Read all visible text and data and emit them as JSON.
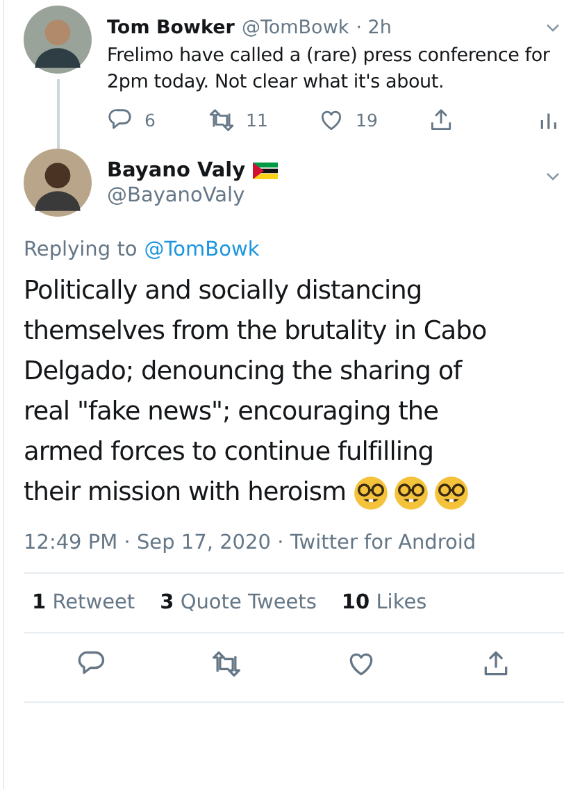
{
  "parent_tweet": {
    "name": "Tom Bowker",
    "handle": "@TomBowk",
    "time": "· 2h",
    "text": "Frelimo have called a (rare) press conference for 2pm today. Not clear what it's about.",
    "actions": [
      {
        "kind": "reply",
        "count": "6"
      },
      {
        "kind": "retweet",
        "count": "11"
      },
      {
        "kind": "like",
        "count": "19"
      },
      {
        "kind": "share"
      },
      {
        "kind": "analytics"
      }
    ]
  },
  "tweet": {
    "name": "Bayano Valy",
    "handle": "@BayanoValy",
    "replying_label": "Replying to",
    "replying_to": "@TomBowk",
    "text_lines": [
      "Politically and socially distancing",
      "themselves from the brutality in Cabo",
      "Delgado; denouncing the sharing of",
      "real \"fake news\"; encouraging the",
      "armed forces to continue fulfilling",
      "their mission with heroism"
    ],
    "emojis": [
      {
        "kind": "nerd-face"
      },
      {
        "kind": "nerd-face"
      },
      {
        "kind": "nerd-face"
      }
    ],
    "meta": "12:49 PM · Sep 17, 2020 · Twitter for Android",
    "stats": [
      {
        "count": "1",
        "label": "Retweet"
      },
      {
        "count": "3",
        "label": "Quote Tweets"
      },
      {
        "count": "10",
        "label": "Likes"
      }
    ],
    "actions": [
      {
        "kind": "reply"
      },
      {
        "kind": "retweet"
      },
      {
        "kind": "like"
      },
      {
        "kind": "share"
      }
    ]
  }
}
